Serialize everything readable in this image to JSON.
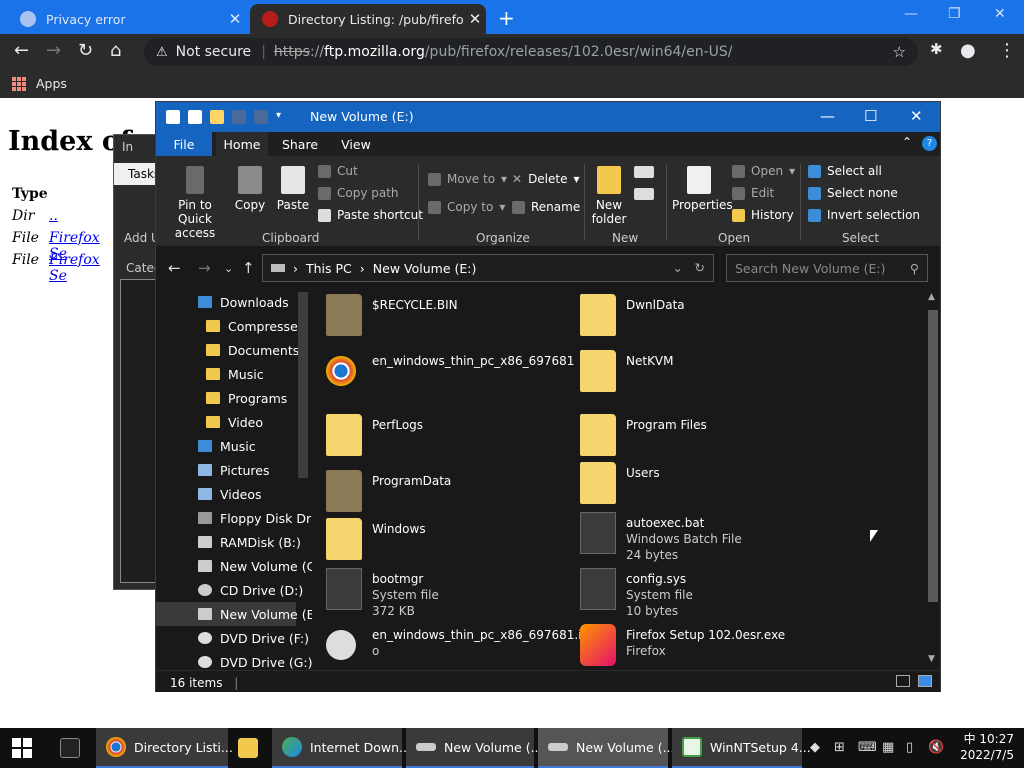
{
  "browser": {
    "tabs": [
      {
        "title": "Privacy error"
      },
      {
        "title": "Directory Listing: /pub/firefox/rel"
      }
    ],
    "new_tab": "+",
    "window_controls": [
      "—",
      "❐",
      "✕"
    ],
    "address": {
      "security": "Not secure",
      "scheme": "https",
      "host": "ftp.mozilla.org",
      "path": "/pub/firefox/releases/102.0esr/win64/en-US/"
    },
    "bookmarks": {
      "apps": "Apps"
    }
  },
  "webpage": {
    "heading": "Index of",
    "type_header": "Type",
    "rows": [
      {
        "type": "Dir",
        "link": ".."
      },
      {
        "type": "File",
        "link": "Firefox Se"
      },
      {
        "type": "File",
        "link": "Firefox Se"
      }
    ]
  },
  "behind_window": {
    "title": "In",
    "menu": "Tasks",
    "add": "Add U",
    "categ": "Categ"
  },
  "explorer": {
    "title": "New Volume (E:)",
    "window_controls": [
      "—",
      "☐",
      "✕"
    ],
    "ribbon_tabs": [
      "File",
      "Home",
      "Share",
      "View"
    ],
    "clipboard": {
      "pin": "Pin to Quick access",
      "copy": "Copy",
      "paste": "Paste",
      "cut": "Cut",
      "copy_path": "Copy path",
      "paste_shortcut": "Paste shortcut",
      "group": "Clipboard"
    },
    "organize": {
      "move_to": "Move to",
      "copy_to": "Copy to",
      "delete": "Delete",
      "rename": "Rename",
      "group": "Organize"
    },
    "new": {
      "new_folder": "New folder",
      "group": "New"
    },
    "open": {
      "properties": "Properties",
      "open": "Open",
      "edit": "Edit",
      "history": "History",
      "group": "Open"
    },
    "select": {
      "select_all": "Select all",
      "select_none": "Select none",
      "invert": "Invert selection",
      "group": "Select"
    },
    "path": [
      "This PC",
      "New Volume (E:)"
    ],
    "search_placeholder": "Search New Volume (E:)",
    "nav_items": [
      {
        "label": "Downloads",
        "icon": "download-icon"
      },
      {
        "label": "Compressed",
        "icon": "folder-icon"
      },
      {
        "label": "Documents",
        "icon": "folder-icon"
      },
      {
        "label": "Music",
        "icon": "folder-icon"
      },
      {
        "label": "Programs",
        "icon": "folder-icon"
      },
      {
        "label": "Video",
        "icon": "folder-icon"
      },
      {
        "label": "Music",
        "icon": "music-icon"
      },
      {
        "label": "Pictures",
        "icon": "pictures-icon"
      },
      {
        "label": "Videos",
        "icon": "videos-icon"
      },
      {
        "label": "Floppy Disk Dri",
        "icon": "floppy-icon"
      },
      {
        "label": "RAMDisk (B:)",
        "icon": "drive-icon"
      },
      {
        "label": "New Volume (C",
        "icon": "drive-icon"
      },
      {
        "label": "CD Drive (D:)",
        "icon": "cd-icon"
      },
      {
        "label": "New Volume (E",
        "icon": "drive-icon"
      },
      {
        "label": "DVD Drive (F:) \\",
        "icon": "dvd-icon"
      },
      {
        "label": "DVD Drive (G:)",
        "icon": "dvd-icon"
      }
    ],
    "items": [
      {
        "name": "$RECYCLE.BIN",
        "icon": "folder-dark"
      },
      {
        "name": "DwnlData",
        "icon": "folder"
      },
      {
        "name": "en_windows_thin_pc_x86_697681",
        "icon": "chrome-file"
      },
      {
        "name": "NetKVM",
        "icon": "folder"
      },
      {
        "name": "PerfLogs",
        "icon": "folder"
      },
      {
        "name": "Program Files",
        "icon": "folder"
      },
      {
        "name": "ProgramData",
        "icon": "folder-dark"
      },
      {
        "name": "Users",
        "icon": "folder"
      },
      {
        "name": "Windows",
        "icon": "folder"
      },
      {
        "name": "autoexec.bat",
        "line2": "Windows Batch File",
        "line3": "24 bytes",
        "icon": "gear-file"
      },
      {
        "name": "bootmgr",
        "line2": "System file",
        "line3": "372 KB",
        "icon": "gear-file"
      },
      {
        "name": "config.sys",
        "line2": "System file",
        "line3": "10 bytes",
        "icon": "gear-file"
      },
      {
        "name": "en_windows_thin_pc_x86_697681.is",
        "line2": "o",
        "icon": "disc-file"
      },
      {
        "name": "Firefox Setup 102.0esr.exe",
        "line2": "Firefox",
        "icon": "firefox-file"
      }
    ],
    "status": "16 items"
  },
  "taskbar": {
    "items": [
      {
        "label": "Directory Listi...",
        "icon": "chrome-icon"
      },
      {
        "label": "Internet Down...",
        "icon": "globe-icon"
      },
      {
        "label": "New Volume (...",
        "icon": "drive-icon"
      },
      {
        "label": "New Volume (...",
        "icon": "drive-icon"
      },
      {
        "label": "WinNTSetup 4...",
        "icon": "setup-icon"
      }
    ],
    "clock": {
      "ime": "中",
      "time": "10:27",
      "date": "2022/7/5"
    }
  }
}
